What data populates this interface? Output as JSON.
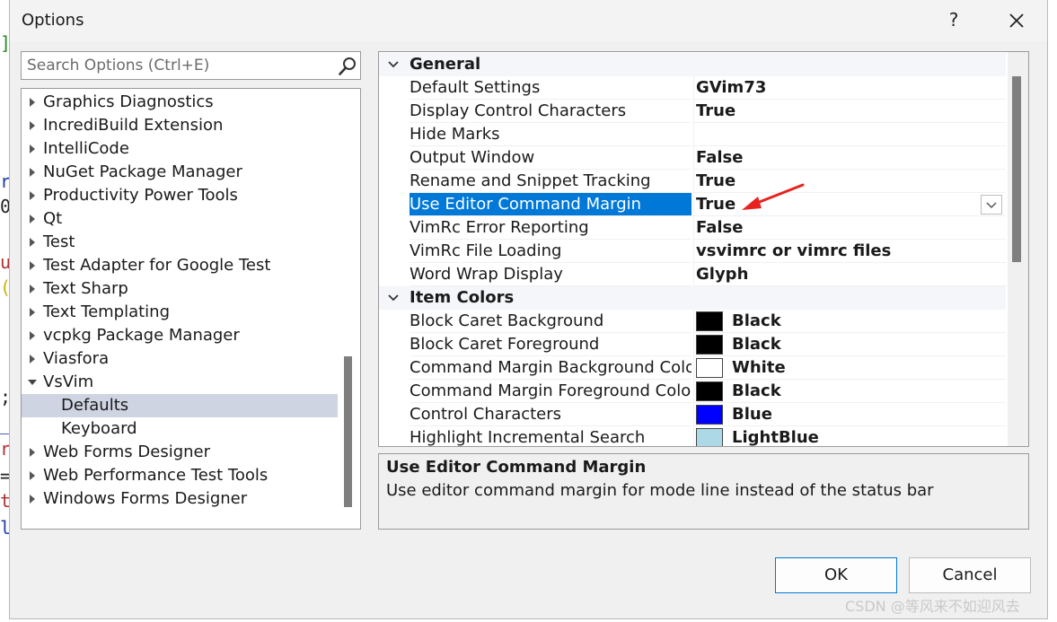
{
  "window": {
    "title": "Options",
    "help_label": "?"
  },
  "search": {
    "placeholder": "Search Options (Ctrl+E)"
  },
  "tree": {
    "items": [
      {
        "label": "Graphics Diagnostics",
        "expand": "collapsed",
        "indent": 0
      },
      {
        "label": "IncrediBuild Extension",
        "expand": "collapsed",
        "indent": 0
      },
      {
        "label": "IntelliCode",
        "expand": "collapsed",
        "indent": 0
      },
      {
        "label": "NuGet Package Manager",
        "expand": "collapsed",
        "indent": 0
      },
      {
        "label": "Productivity Power Tools",
        "expand": "collapsed",
        "indent": 0
      },
      {
        "label": "Qt",
        "expand": "collapsed",
        "indent": 0
      },
      {
        "label": "Test",
        "expand": "collapsed",
        "indent": 0
      },
      {
        "label": "Test Adapter for Google Test",
        "expand": "collapsed",
        "indent": 0
      },
      {
        "label": "Text Sharp",
        "expand": "collapsed",
        "indent": 0
      },
      {
        "label": "Text Templating",
        "expand": "collapsed",
        "indent": 0
      },
      {
        "label": "vcpkg Package Manager",
        "expand": "collapsed",
        "indent": 0
      },
      {
        "label": "Viasfora",
        "expand": "collapsed",
        "indent": 0
      },
      {
        "label": "VsVim",
        "expand": "expanded",
        "indent": 0
      },
      {
        "label": "Defaults",
        "expand": "none",
        "indent": 1,
        "selected": true
      },
      {
        "label": "Keyboard",
        "expand": "none",
        "indent": 1
      },
      {
        "label": "Web Forms Designer",
        "expand": "collapsed",
        "indent": 0
      },
      {
        "label": "Web Performance Test Tools",
        "expand": "collapsed",
        "indent": 0
      },
      {
        "label": "Windows Forms Designer",
        "expand": "collapsed",
        "indent": 0
      }
    ]
  },
  "grid": {
    "rows": [
      {
        "type": "category",
        "label": "General"
      },
      {
        "type": "prop",
        "name": "Default Settings",
        "value": "GVim73"
      },
      {
        "type": "prop",
        "name": "Display Control Characters",
        "value": "True"
      },
      {
        "type": "prop",
        "name": "Hide Marks",
        "value": ""
      },
      {
        "type": "prop",
        "name": "Output Window",
        "value": "False"
      },
      {
        "type": "prop",
        "name": "Rename and Snippet Tracking",
        "value": "True"
      },
      {
        "type": "prop",
        "name": "Use Editor Command Margin",
        "value": "True",
        "selected": true
      },
      {
        "type": "prop",
        "name": "VimRc Error Reporting",
        "value": "False"
      },
      {
        "type": "prop",
        "name": "VimRc File Loading",
        "value": "vsvimrc or vimrc files"
      },
      {
        "type": "prop",
        "name": "Word Wrap Display",
        "value": "Glyph"
      },
      {
        "type": "category",
        "label": "Item Colors"
      },
      {
        "type": "color",
        "name": "Block Caret Background",
        "value": "Black",
        "swatch": "#000000"
      },
      {
        "type": "color",
        "name": "Block Caret Foreground",
        "value": "Black",
        "swatch": "#000000"
      },
      {
        "type": "color",
        "name": "Command Margin Background Color",
        "value": "White",
        "swatch": "#ffffff"
      },
      {
        "type": "color",
        "name": "Command Margin Foreground Color",
        "value": "Black",
        "swatch": "#000000"
      },
      {
        "type": "color",
        "name": "Control Characters",
        "value": "Blue",
        "swatch": "#0000ff"
      },
      {
        "type": "color",
        "name": "Highlight Incremental Search",
        "value": "LightBlue",
        "swatch": "#add8e6"
      }
    ]
  },
  "description": {
    "title": "Use Editor Command Margin",
    "text": "Use editor command margin for mode line instead of the status bar"
  },
  "buttons": {
    "ok_label": "OK",
    "cancel_label": "Cancel"
  },
  "watermark": "CSDN @等风来不如迎风去",
  "colors": {
    "selection": "#0078d7",
    "tree_selection": "#cfd4e2",
    "annotation_arrow": "#e8231f"
  }
}
